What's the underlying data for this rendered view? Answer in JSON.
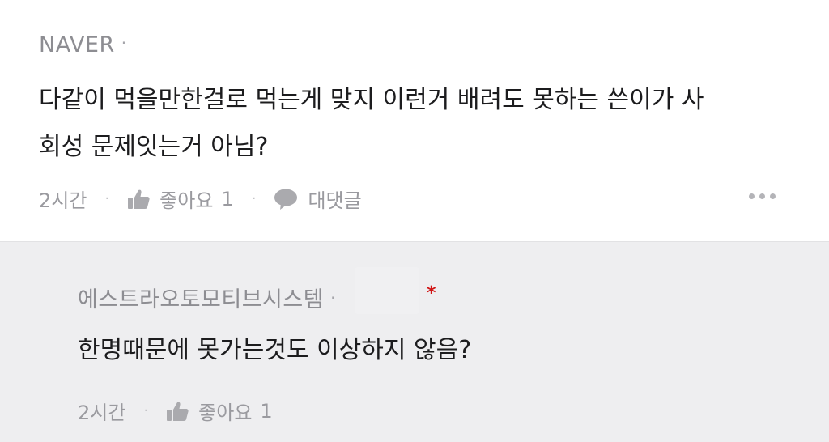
{
  "comment": {
    "author": "NAVER",
    "author_dot": "·",
    "content_line1": "다같이 먹을만한걸로 먹는게 맞지 이런거 배려도 못하는 쓴이가 사",
    "content_line2": "회성 문제잇는거 아님?",
    "time": "2시간",
    "separator": "·",
    "like_label": "좋아요",
    "like_count": "1",
    "reply_label": "대댓글",
    "more_icon": "more-horizontal-icon"
  },
  "reply": {
    "author": "에스트라오토모티브시스템",
    "author_dot": "·",
    "marker": "*",
    "content": "한명때문에 못가는것도 이상하지 않음?",
    "time": "2시간",
    "separator": "·",
    "like_label": "좋아요",
    "like_count": "1"
  },
  "colors": {
    "reply_background": "#eeeef0",
    "text_primary": "#1c1c1e",
    "text_secondary": "#8d8d92",
    "marker": "#d01414"
  }
}
